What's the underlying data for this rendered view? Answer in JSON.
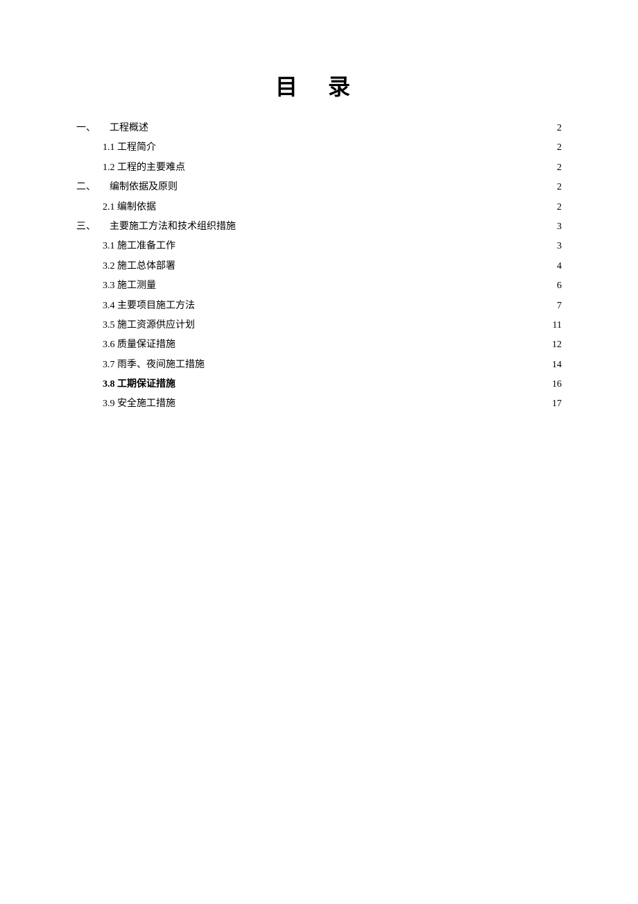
{
  "title": "目 录",
  "toc": [
    {
      "level": 1,
      "ord": "一、",
      "label": "工程概述",
      "page": "2",
      "bold": false
    },
    {
      "level": 2,
      "ord": "",
      "label": "1.1 工程简介",
      "page": "2",
      "bold": false
    },
    {
      "level": 2,
      "ord": "",
      "label": "1.2 工程的主要难点",
      "page": "2",
      "bold": false
    },
    {
      "level": 1,
      "ord": "二、",
      "label": "编制依据及原则",
      "page": "2",
      "bold": false
    },
    {
      "level": 2,
      "ord": "",
      "label": "2.1 编制依据",
      "page": "2",
      "bold": false
    },
    {
      "level": 1,
      "ord": "三、",
      "label": "主要施工方法和技术组织措施",
      "page": "3",
      "bold": false
    },
    {
      "level": 2,
      "ord": "",
      "label": "3.1 施工准备工作",
      "page": "3",
      "bold": false
    },
    {
      "level": 2,
      "ord": "",
      "label": "3.2 施工总体部署",
      "page": "4",
      "bold": false
    },
    {
      "level": 2,
      "ord": "",
      "label": "3.3 施工测量",
      "page": "6",
      "bold": false
    },
    {
      "level": 2,
      "ord": "",
      "label": "3.4 主要项目施工方法",
      "page": "7",
      "bold": false
    },
    {
      "level": 2,
      "ord": "",
      "label": "3.5 施工资源供应计划",
      "page": "11",
      "bold": false
    },
    {
      "level": 2,
      "ord": "",
      "label": "3.6 质量保证措施",
      "page": "12",
      "bold": false
    },
    {
      "level": 2,
      "ord": "",
      "label": "3.7 雨季、夜间施工措施",
      "page": "14",
      "bold": false
    },
    {
      "level": 2,
      "ord": "",
      "label": "3.8 工期保证措施",
      "page": "16",
      "bold": true
    },
    {
      "level": 2,
      "ord": "",
      "label": "3.9 安全施工措施",
      "page": "17",
      "bold": false
    }
  ]
}
